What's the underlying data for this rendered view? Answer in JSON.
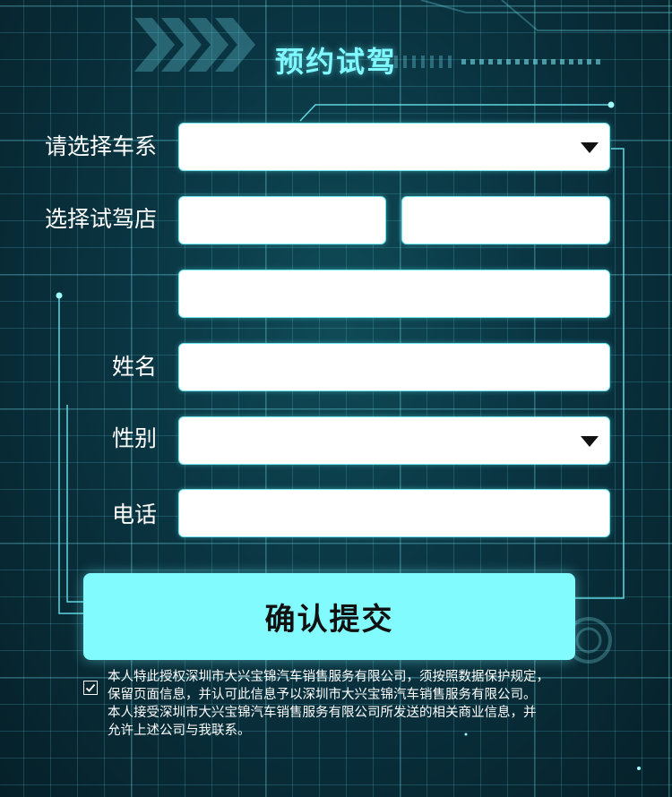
{
  "form": {
    "title": "预约试驾",
    "labels": {
      "car_series": "请选择车系",
      "dealer": "选择试驾店",
      "name": "姓名",
      "gender": "性别",
      "phone": "电话"
    },
    "fields": {
      "car_series": "",
      "province": "",
      "city": "",
      "dealer": "",
      "name": "",
      "gender": "",
      "phone": ""
    },
    "submit_label": "确认提交"
  },
  "consent": {
    "checked": true,
    "lines": [
      "本人特此授权深圳市大兴宝锦汽车销售服务有限公司，须按照数据保护规定，",
      "保留页面信息，并认可此信息予以深圳市大兴宝锦汽车销售服务有限公司。",
      "本人接受深圳市大兴宝锦汽车销售服务有限公司所发送的相关商业信息，并",
      "允许上述公司与我联系。"
    ]
  },
  "colors": {
    "accent": "#82fbff",
    "title": "#7ff8ff",
    "background": "#0a3441"
  },
  "icons": {
    "dropdown": "caret-down-icon",
    "checkbox": "checkmark-icon"
  }
}
